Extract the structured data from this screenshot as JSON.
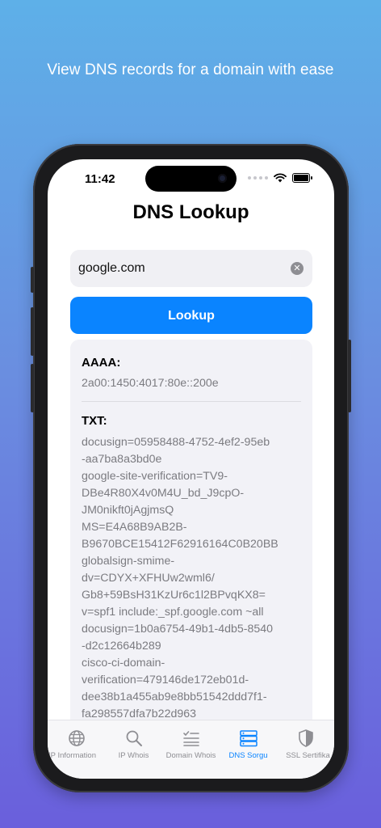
{
  "headline": "View DNS records for a domain with ease",
  "status_bar": {
    "time": "11:42"
  },
  "page_title": "DNS Lookup",
  "search": {
    "value": "google.com",
    "placeholder": ""
  },
  "lookup_button": "Lookup",
  "records": [
    {
      "label": "AAAA:",
      "values": [
        "2a00:1450:4017:80e::200e"
      ]
    },
    {
      "label": "TXT:",
      "values": [
        "docusign=05958488-4752-4ef2-95eb",
        "-aa7ba8a3bd0e",
        "google-site-verification=TV9-",
        "DBe4R80X4v0M4U_bd_J9cpO-",
        "JM0nikft0jAgjmsQ",
        "MS=E4A68B9AB2B-",
        "B9670BCE15412F62916164C0B20BB",
        "globalsign-smime-",
        "dv=CDYX+XFHUw2wml6/",
        "Gb8+59BsH31KzUr6c1l2BPvqKX8=",
        "v=spf1 include:_spf.google.com ~all",
        "docusign=1b0a6754-49b1-4db5-8540",
        "-d2c12664b289",
        "cisco-ci-domain-",
        "verification=479146de172eb01d-",
        "dee38b1a455ab9e8bb51542ddd7f1-",
        "fa298557dfa7b22d963"
      ]
    }
  ],
  "tabs": [
    {
      "label": "IP Information",
      "icon": "globe-icon",
      "active": false
    },
    {
      "label": "IP Whois",
      "icon": "magnifier-icon",
      "active": false
    },
    {
      "label": "Domain Whois",
      "icon": "checklist-icon",
      "active": false
    },
    {
      "label": "DNS Sorgu",
      "icon": "server-icon",
      "active": true
    },
    {
      "label": "SSL Sertifika",
      "icon": "shield-icon",
      "active": false
    }
  ],
  "colors": {
    "accent": "#0a84ff",
    "background_top": "#5eb0e8",
    "background_bottom": "#6a5fdc"
  }
}
